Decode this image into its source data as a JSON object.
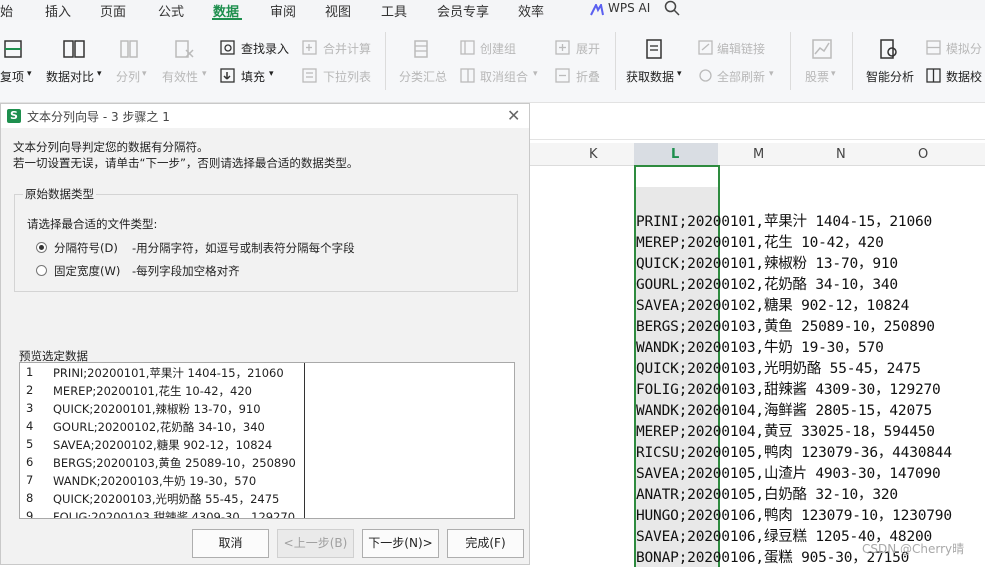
{
  "menubar": {
    "items": [
      "始",
      "插入",
      "页面",
      "公式",
      "数据",
      "审阅",
      "视图",
      "工具",
      "会员专享",
      "效率"
    ],
    "active": "数据",
    "wps_ai": "WPS AI"
  },
  "ribbon": {
    "fuxiang": "复项",
    "data_compare": "数据对比",
    "split": "分列",
    "validity": "有效性",
    "find_entry": "查找录入",
    "fill": "填充",
    "merge_calc": "合并计算",
    "dropdown_list": "下拉列表",
    "subtotal": "分类汇总",
    "create_group": "创建组",
    "ungroup": "取消组合",
    "expand": "展开",
    "collapse": "折叠",
    "get_data": "获取数据",
    "edit_links": "编辑链接",
    "refresh_all": "全部刷新",
    "stock": "股票",
    "smart_analysis": "智能分析",
    "simulate": "模拟分",
    "data_check": "数据校"
  },
  "sheet": {
    "columns": [
      "K",
      "L",
      "M",
      "N",
      "O"
    ],
    "rows": [
      "PRINI;20200101,苹果汁 1404-15，21060",
      "MEREP;20200101,花生 10-42，420",
      "QUICK;20200101,辣椒粉 13-70，910",
      "GOURL;20200102,花奶酪 34-10，340",
      "SAVEA;20200102,糖果 902-12，10824",
      "BERGS;20200103,黄鱼 25089-10，250890",
      "WANDK;20200103,牛奶 19-30，570",
      "QUICK;20200103,光明奶酪 55-45，2475",
      "FOLIG;20200103,甜辣酱 4309-30，129270",
      "WANDK;20200104,海鲜酱 2805-15，42075",
      "MEREP;20200104,黄豆 33025-18，594450",
      "RICSU;20200105,鸭肉 123079-36，4430844",
      "SAVEA;20200105,山渣片 4903-30，147090",
      "ANATR;20200105,白奶酪 32-10，320",
      "HUNGO;20200106,鸭肉 123079-10，1230790",
      "SAVEA;20200106,绿豆糕 1205-40，48200",
      "BONAP;20200106,蛋糕 905-30，27150"
    ],
    "watermark": "CSDN @Cherry晴"
  },
  "dialog": {
    "title": "文本分列向导 - 3 步骤之 1",
    "logo": "S",
    "intro_line1": "文本分列向导判定您的数据有分隔符。",
    "intro_line2": "若一切设置无误，请单击“下一步”，否则请选择最合适的数据类型。",
    "group_title": "原始数据类型",
    "choose_label": "请选择最合适的文件类型:",
    "option_delimited": "分隔符号(D)",
    "option_delimited_desc": "-用分隔字符，如逗号或制表符分隔每个字段",
    "option_fixed": "固定宽度(W)",
    "option_fixed_desc": "-每列字段加空格对齐",
    "selected_option": "delimited",
    "preview_label": "预览选定数据",
    "preview_rows": [
      {
        "num": "1",
        "text": "PRINI;20200101,苹果汁 1404-15，21060"
      },
      {
        "num": "2",
        "text": "MEREP;20200101,花生 10-42，420"
      },
      {
        "num": "3",
        "text": "QUICK;20200101,辣椒粉 13-70，910"
      },
      {
        "num": "4",
        "text": "GOURL;20200102,花奶酪 34-10，340"
      },
      {
        "num": "5",
        "text": "SAVEA;20200102,糖果 902-12，10824"
      },
      {
        "num": "6",
        "text": "BERGS;20200103,黄鱼 25089-10，250890"
      },
      {
        "num": "7",
        "text": "WANDK;20200103,牛奶 19-30，570"
      },
      {
        "num": "8",
        "text": "QUICK;20200103,光明奶酪 55-45，2475"
      },
      {
        "num": "9",
        "text": "FOLIG;20200103,甜辣酱 4309-30，129270"
      }
    ],
    "buttons": {
      "cancel": "取消",
      "prev": "<上一步(B)",
      "next": "下一步(N)>",
      "finish": "完成(F)"
    }
  },
  "colors": {
    "accent": "#1e8f4e",
    "selection_border": "#2e8b3f"
  }
}
